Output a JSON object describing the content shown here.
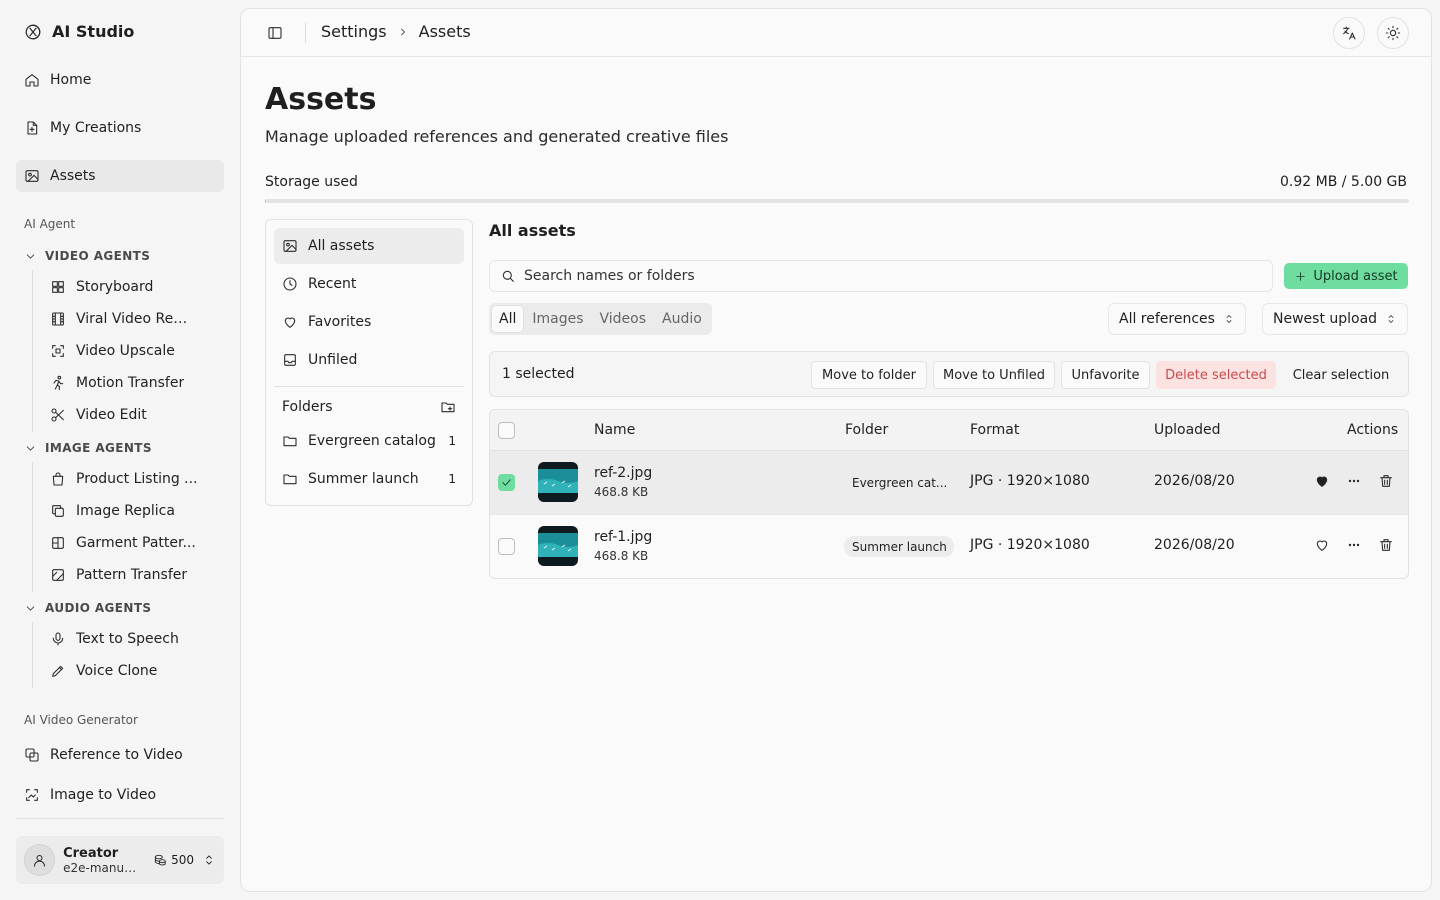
{
  "app": {
    "title": "AI Studio"
  },
  "sidebar": {
    "nav": [
      {
        "label": "Home",
        "icon": "home-icon"
      },
      {
        "label": "My Creations",
        "icon": "file-icon"
      },
      {
        "label": "Assets",
        "icon": "image-icon",
        "active": true
      }
    ],
    "section_ai_agent": "AI Agent",
    "video_agents": {
      "title": "VIDEO AGENTS",
      "items": [
        "Storyboard",
        "Viral Video Rem...",
        "Video Upscale",
        "Motion Transfer",
        "Video Edit"
      ]
    },
    "image_agents": {
      "title": "IMAGE AGENTS",
      "items": [
        "Product Listing ...",
        "Image Replica",
        "Garment Patter...",
        "Pattern Transfer"
      ]
    },
    "audio_agents": {
      "title": "AUDIO AGENTS",
      "items": [
        "Text to Speech",
        "Voice Clone"
      ]
    },
    "section_generator": "AI Video Generator",
    "generator_items": [
      "Reference to Video",
      "Image to Video"
    ],
    "user": {
      "name": "Creator",
      "email": "e2e-manua...",
      "credits": "500"
    }
  },
  "header": {
    "breadcrumb": [
      "Settings",
      "Assets"
    ]
  },
  "page": {
    "title": "Assets",
    "subtitle": "Manage uploaded references and generated creative files",
    "storage_label": "Storage used",
    "storage_value": "0.92 MB / 5.00 GB",
    "storage_fraction": 0.0002
  },
  "filters": {
    "items": [
      "All assets",
      "Recent",
      "Favorites",
      "Unfiled"
    ],
    "folders_label": "Folders",
    "folders": [
      {
        "name": "Evergreen catalog",
        "count": "1"
      },
      {
        "name": "Summer launch",
        "count": "1"
      }
    ]
  },
  "content": {
    "title": "All assets",
    "search_placeholder": "Search names or folders",
    "upload_label": "Upload asset",
    "tabs": [
      "All",
      "Images",
      "Videos",
      "Audio"
    ],
    "reference_filter": "All references",
    "sort": "Newest upload"
  },
  "selection": {
    "count_text": "1 selected",
    "actions": [
      "Move to folder",
      "Move to Unfiled",
      "Unfavorite",
      "Delete selected",
      "Clear selection"
    ]
  },
  "table": {
    "headers": [
      "Name",
      "Folder",
      "Format",
      "Uploaded",
      "Actions"
    ],
    "rows": [
      {
        "name": "ref-2.jpg",
        "size": "468.8 KB",
        "folder": "Evergreen cat...",
        "format": "JPG · 1920×1080",
        "uploaded": "2026/08/20",
        "selected": true,
        "favorite": true
      },
      {
        "name": "ref-1.jpg",
        "size": "468.8 KB",
        "folder": "Summer launch",
        "format": "JPG · 1920×1080",
        "uploaded": "2026/08/20",
        "selected": false,
        "favorite": false
      }
    ]
  },
  "colors": {
    "accent": "#6fdca0",
    "danger": "#c94a4a",
    "danger_bg": "#fde2e2"
  }
}
